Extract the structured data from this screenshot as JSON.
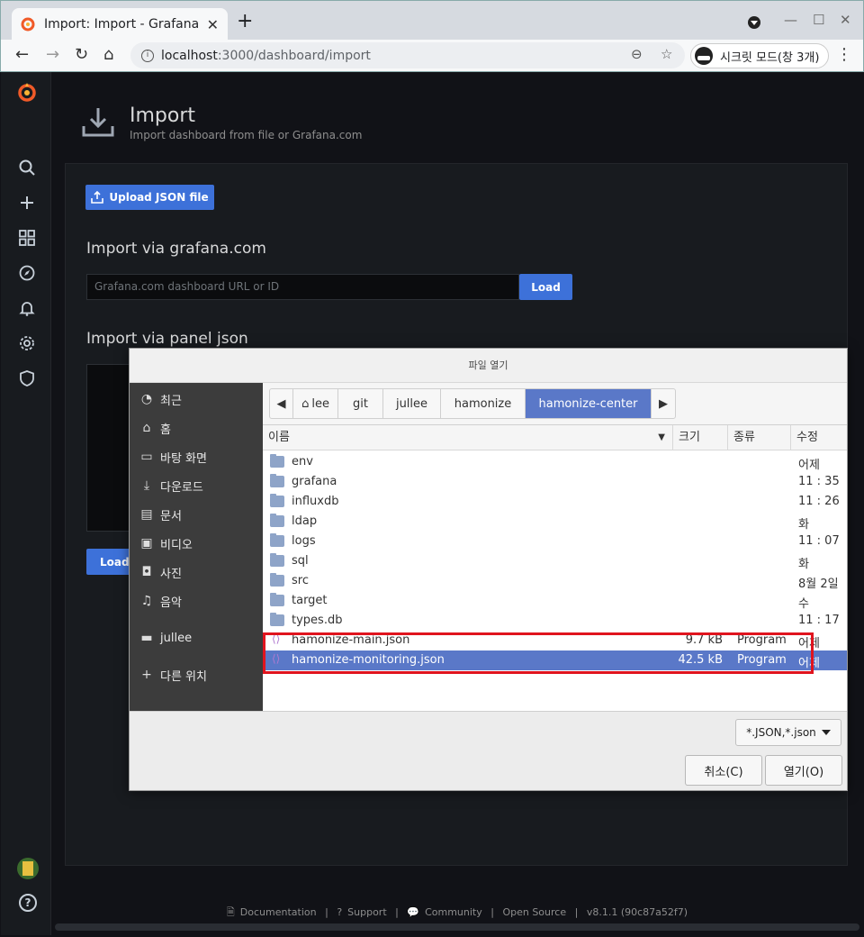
{
  "browser": {
    "tab_title": "Import: Import - Grafana",
    "tab_close": "✕",
    "new_tab": "+",
    "url_host": "localhost",
    "url_path": ":3000/dashboard/import",
    "incognito_label": "시크릿 모드(창 3개)",
    "accent": "#f05a28"
  },
  "page": {
    "title": "Import",
    "subtitle": "Import dashboard from file or Grafana.com",
    "upload_label": "Upload JSON file",
    "via_grafana_heading": "Import via grafana.com",
    "grafana_placeholder": "Grafana.com dashboard URL or ID",
    "load_label": "Load",
    "via_panel_heading": "Import via panel json",
    "load2_label": "Load"
  },
  "footer": {
    "documentation": "Documentation",
    "support": "Support",
    "community": "Community",
    "open_source": "Open Source",
    "version": "v8.1.1 (90c87a52f7)"
  },
  "dialog": {
    "title": "파일 열기",
    "places": [
      {
        "label": "최근",
        "icon": "clock-icon"
      },
      {
        "label": "홈",
        "icon": "home-icon"
      },
      {
        "label": "바탕 화면",
        "icon": "desktop-icon"
      },
      {
        "label": "다운로드",
        "icon": "download-icon"
      },
      {
        "label": "문서",
        "icon": "document-icon"
      },
      {
        "label": "비디오",
        "icon": "video-icon"
      },
      {
        "label": "사진",
        "icon": "camera-icon"
      },
      {
        "label": "음악",
        "icon": "music-icon"
      },
      {
        "label": "jullee",
        "icon": "folder-icon"
      },
      {
        "label": "다른 위치",
        "icon": "plus-icon"
      }
    ],
    "breadcrumbs": [
      "lee",
      "git",
      "jullee",
      "hamonize",
      "hamonize-center"
    ],
    "columns": {
      "name": "이름",
      "size": "크기",
      "type": "종류",
      "modified": "수정"
    },
    "files": [
      {
        "name": "env",
        "size": "",
        "type": "",
        "modified": "어제",
        "kind": "folder"
      },
      {
        "name": "grafana",
        "size": "",
        "type": "",
        "modified": "11 : 35",
        "kind": "folder"
      },
      {
        "name": "influxdb",
        "size": "",
        "type": "",
        "modified": "11 : 26",
        "kind": "folder"
      },
      {
        "name": "ldap",
        "size": "",
        "type": "",
        "modified": "화",
        "kind": "folder"
      },
      {
        "name": "logs",
        "size": "",
        "type": "",
        "modified": "11 : 07",
        "kind": "folder"
      },
      {
        "name": "sql",
        "size": "",
        "type": "",
        "modified": "화",
        "kind": "folder"
      },
      {
        "name": "src",
        "size": "",
        "type": "",
        "modified": "8월 2일",
        "kind": "folder"
      },
      {
        "name": "target",
        "size": "",
        "type": "",
        "modified": "수",
        "kind": "folder"
      },
      {
        "name": "types.db",
        "size": "",
        "type": "",
        "modified": "11 : 17",
        "kind": "folder"
      },
      {
        "name": "hamonize-main.json",
        "size": "9.7 kB",
        "type": "Program",
        "modified": "어제",
        "kind": "json"
      },
      {
        "name": "hamonize-monitoring.json",
        "size": "42.5 kB",
        "type": "Program",
        "modified": "어제",
        "kind": "json",
        "selected": true
      }
    ],
    "filter_label": "*.JSON,*.json",
    "cancel_label": "취소(C)",
    "open_label": "열기(O)"
  }
}
